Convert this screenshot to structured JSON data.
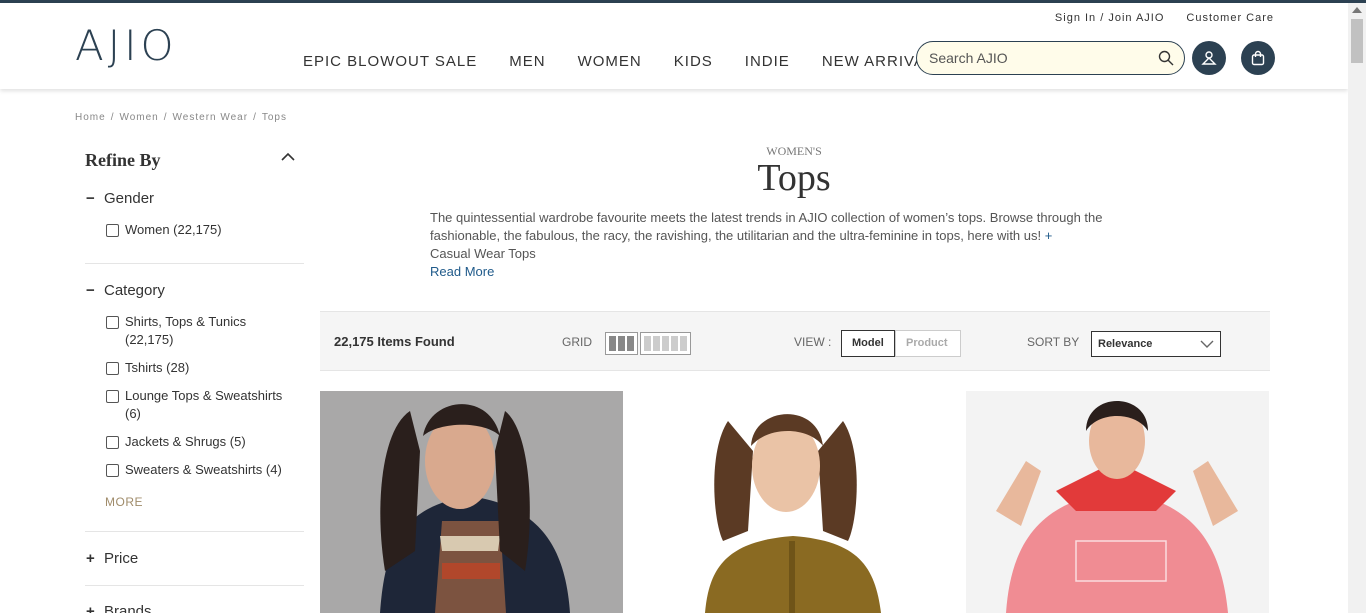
{
  "header": {
    "logo": "AJIO",
    "top_links": [
      "Sign In / Join AJIO",
      "Customer Care"
    ],
    "nav": [
      "EPIC BLOWOUT SALE",
      "MEN",
      "WOMEN",
      "KIDS",
      "INDIE",
      "NEW ARRIVALS"
    ],
    "search_placeholder": "Search AJIO"
  },
  "breadcrumb": [
    "Home",
    "/",
    "Women",
    "/",
    "Western Wear",
    "/",
    "Tops"
  ],
  "filters": {
    "title": "Refine By",
    "gender": {
      "label": "Gender",
      "sign": "−",
      "options": [
        "Women (22,175)"
      ]
    },
    "category": {
      "label": "Category",
      "sign": "−",
      "options": [
        "Shirts, Tops & Tunics (22,175)",
        "Tshirts (28)",
        "Lounge Tops & Sweatshirts (6)",
        "Jackets & Shrugs (5)",
        "Sweaters & Sweatshirts (4)"
      ],
      "more": "MORE"
    },
    "price": {
      "label": "Price",
      "sign": "+"
    },
    "brands": {
      "label": "Brands",
      "sign": "+"
    }
  },
  "page": {
    "subtitle": "WOMEN'S",
    "title": "Tops",
    "description": "The quintessential wardrobe favourite meets the latest trends in AJIO collection of women’s tops. Browse through the fashionable, the fabulous, the racy, the ravishing, the utilitarian and the ultra-feminine in tops, here with us!",
    "plus": "+",
    "description_link": "Casual Wear Tops",
    "read_more": "Read More"
  },
  "toolbar": {
    "items_found": "22,175 Items Found",
    "grid_label": "GRID",
    "view_label": "VIEW :",
    "view_model": "Model",
    "view_product": "Product",
    "sort_label": "SORT BY",
    "sort_value": "Relevance"
  },
  "colors": {
    "brand": "#2c4152",
    "search_bg": "#fffcea",
    "link": "#1f5a8a",
    "more": "#a08c6b"
  }
}
